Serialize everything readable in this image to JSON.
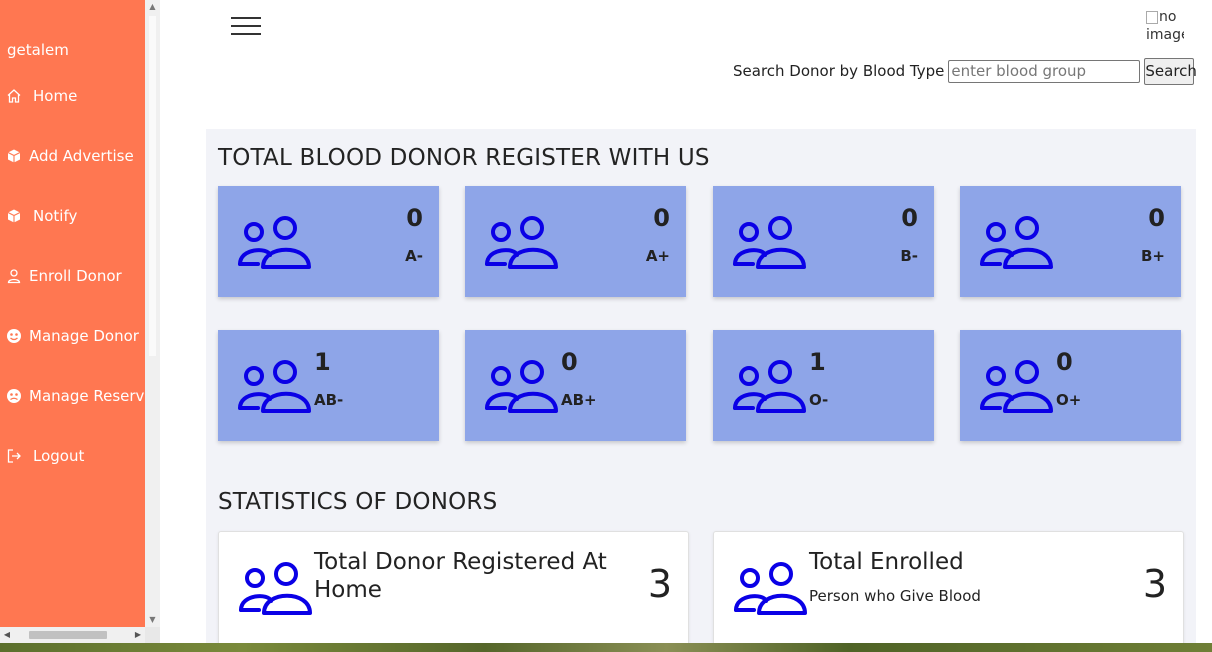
{
  "sidebar": {
    "username": "getalem",
    "items": [
      {
        "label": "Home",
        "icon": "home-icon"
      },
      {
        "label": "Add Advertise",
        "icon": "cube-icon"
      },
      {
        "label": "Notify",
        "icon": "cube-icon"
      },
      {
        "label": "Enroll Donor",
        "icon": "user-icon"
      },
      {
        "label": "Manage Donor",
        "icon": "smile-icon"
      },
      {
        "label": "Manage Reservation",
        "icon": "smile-icon"
      },
      {
        "label": "Logout",
        "icon": "logout-icon"
      }
    ],
    "background": "#ff7751"
  },
  "header": {
    "avatar_alt": "no image",
    "search": {
      "label": "Search Donor by Blood Type",
      "placeholder": "enter blood group",
      "value": "",
      "button": "Search"
    }
  },
  "blood_section": {
    "title": "TOTAL BLOOD DONOR REGISTER WITH US",
    "cards": [
      {
        "type": "A-",
        "count": "0"
      },
      {
        "type": "A+",
        "count": "0"
      },
      {
        "type": "B-",
        "count": "0"
      },
      {
        "type": "B+",
        "count": "0"
      },
      {
        "type": "AB-",
        "count": "1"
      },
      {
        "type": "AB+",
        "count": "0"
      },
      {
        "type": "O-",
        "count": "1"
      },
      {
        "type": "O+",
        "count": "0"
      }
    ],
    "card_color": "#8ea5e8",
    "icon_color": "#0a00e6"
  },
  "stats_section": {
    "title": "STATISTICS OF DONORS",
    "cards": [
      {
        "title": "Total Donor Registered At Home",
        "subtitle": "",
        "value": "3"
      },
      {
        "title": "Total Enrolled",
        "subtitle": "Person who Give Blood",
        "value": "3"
      }
    ]
  }
}
